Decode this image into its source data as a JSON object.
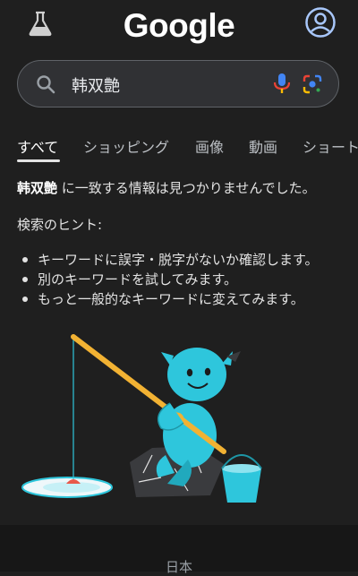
{
  "header": {
    "labs_icon": "flask-icon",
    "logo_text": "Google",
    "account_icon": "account-circle-icon"
  },
  "search": {
    "query": "韩双艶",
    "icons": [
      "search-icon",
      "microphone-icon",
      "google-lens-icon"
    ]
  },
  "tabs": [
    {
      "label": "すべて",
      "active": true
    },
    {
      "label": "ショッピング",
      "active": false
    },
    {
      "label": "画像",
      "active": false
    },
    {
      "label": "動画",
      "active": false
    },
    {
      "label": "ショート",
      "active": false
    }
  ],
  "results": {
    "query_bold": "韩双艶",
    "no_match_text": " に一致する情報は見つかりませんでした。",
    "hint_title": "検索のヒント:",
    "hints": [
      "キーワードに誤字・脱字がないか確認します。",
      "別のキーワードを試してみます。",
      "もっと一般的なキーワードに変えてみます。"
    ]
  },
  "footer": {
    "region": "日本"
  },
  "colors": {
    "background": "#1f1f1f",
    "search_box": "#303134",
    "account_accent": "#a8c7fa",
    "mascot": "#2ec6dc",
    "fishing_rod": "#f2b233"
  }
}
